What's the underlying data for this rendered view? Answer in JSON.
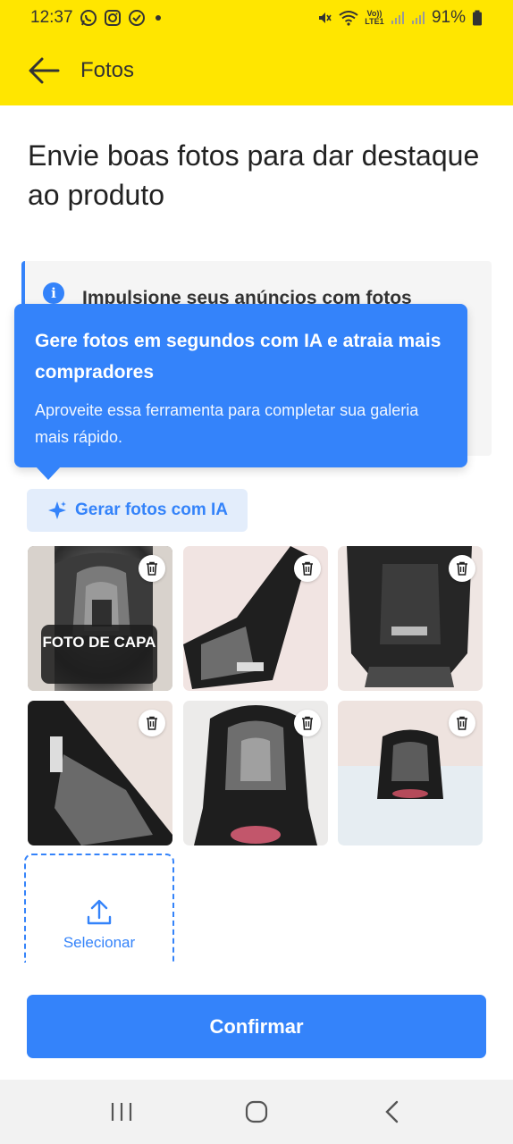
{
  "status_bar": {
    "time": "12:37",
    "volte": "Vo)) LTE1",
    "battery": "91%",
    "icons": [
      "whatsapp-icon",
      "instagram-icon",
      "notification-icon",
      "dot-icon",
      "mute-icon",
      "wifi-icon",
      "signal-icon",
      "signal-icon",
      "battery-icon"
    ]
  },
  "app_bar": {
    "title": "Fotos"
  },
  "heading": "Envie boas fotos para dar destaque ao produto",
  "info_card": {
    "text": "Impulsione seus anúncios com fotos"
  },
  "tooltip": {
    "title": "Gere fotos em segundos com IA e atraia mais compradores",
    "body": "Aproveite essa ferramenta para completar sua galeria mais rápido."
  },
  "ia_button": {
    "label": "Gerar fotos com IA"
  },
  "photos": {
    "cover_label": "FOTO DE CAPA",
    "count": 6
  },
  "select": {
    "label": "Selecionar"
  },
  "confirm": {
    "label": "Confirmar"
  },
  "colors": {
    "brand_yellow": "#ffe600",
    "accent_blue": "#3483fa"
  }
}
